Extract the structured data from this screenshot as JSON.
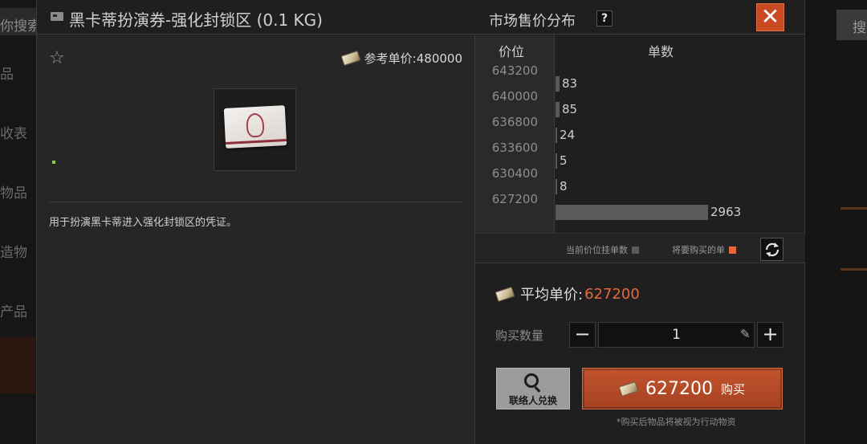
{
  "background": {
    "left_search_label": "你搜索",
    "left_items": [
      "品",
      "收表",
      "物品",
      "造物",
      "产品"
    ],
    "right_search_label": "搜"
  },
  "header": {
    "item_title": "黑卡蒂扮演券-强化封锁区 (0.1 KG)",
    "market_title": "市场售价分布",
    "help_label": "?",
    "close_label": "✕"
  },
  "item": {
    "ref_price_label": "参考单价:480000",
    "description": "用于扮演黑卡蒂进入强化封锁区的凭证。"
  },
  "market": {
    "col_price": "价位",
    "col_count": "单数",
    "legend_current": "当前价位挂单数",
    "legend_buy": "将要购买的单",
    "colors": {
      "current": "#5a5a5a",
      "buy": "#e8683a"
    }
  },
  "chart_data": {
    "type": "bar",
    "orientation": "horizontal",
    "categories": [
      "643200",
      "640000",
      "636800",
      "633600",
      "630400",
      "627200"
    ],
    "values": [
      83,
      85,
      24,
      5,
      8,
      2963
    ],
    "xlabel": "单数",
    "ylabel": "价位"
  },
  "purchase": {
    "avg_label": "平均单价:",
    "avg_value": "627200",
    "qty_label": "购买数量",
    "qty_minus": "−",
    "qty_value": "1",
    "qty_plus": "+",
    "contact_label": "联络人兑换",
    "buy_price": "627200",
    "buy_label": "购买",
    "note": "*购买后物品将被视为行动物资"
  }
}
